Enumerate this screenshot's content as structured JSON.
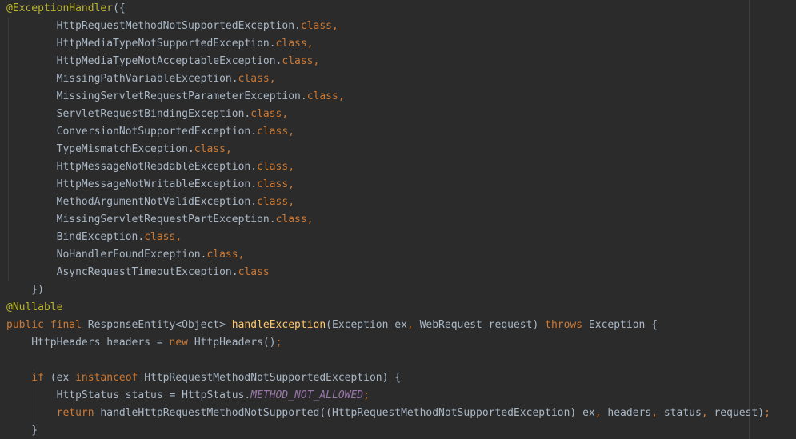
{
  "code": {
    "lines": [
      [
        {
          "t": "@ExceptionHandler",
          "k": "annotation"
        },
        {
          "t": "({",
          "k": "plain"
        }
      ],
      [
        {
          "t": "        HttpRequestMethodNotSupportedException.",
          "k": "plain"
        },
        {
          "t": "class",
          "k": "keyword"
        },
        {
          "t": ",",
          "k": "keyword"
        }
      ],
      [
        {
          "t": "        HttpMediaTypeNotSupportedException.",
          "k": "plain"
        },
        {
          "t": "class",
          "k": "keyword"
        },
        {
          "t": ",",
          "k": "keyword"
        }
      ],
      [
        {
          "t": "        HttpMediaTypeNotAcceptableException.",
          "k": "plain"
        },
        {
          "t": "class",
          "k": "keyword"
        },
        {
          "t": ",",
          "k": "keyword"
        }
      ],
      [
        {
          "t": "        MissingPathVariableException.",
          "k": "plain"
        },
        {
          "t": "class",
          "k": "keyword"
        },
        {
          "t": ",",
          "k": "keyword"
        }
      ],
      [
        {
          "t": "        MissingServletRequestParameterException.",
          "k": "plain"
        },
        {
          "t": "class",
          "k": "keyword"
        },
        {
          "t": ",",
          "k": "keyword"
        }
      ],
      [
        {
          "t": "        ServletRequestBindingException.",
          "k": "plain"
        },
        {
          "t": "class",
          "k": "keyword"
        },
        {
          "t": ",",
          "k": "keyword"
        }
      ],
      [
        {
          "t": "        ConversionNotSupportedException.",
          "k": "plain"
        },
        {
          "t": "class",
          "k": "keyword"
        },
        {
          "t": ",",
          "k": "keyword"
        }
      ],
      [
        {
          "t": "        TypeMismatchException.",
          "k": "plain"
        },
        {
          "t": "class",
          "k": "keyword"
        },
        {
          "t": ",",
          "k": "keyword"
        }
      ],
      [
        {
          "t": "        HttpMessageNotReadableException.",
          "k": "plain"
        },
        {
          "t": "class",
          "k": "keyword"
        },
        {
          "t": ",",
          "k": "keyword"
        }
      ],
      [
        {
          "t": "        HttpMessageNotWritableException.",
          "k": "plain"
        },
        {
          "t": "class",
          "k": "keyword"
        },
        {
          "t": ",",
          "k": "keyword"
        }
      ],
      [
        {
          "t": "        MethodArgumentNotValidException.",
          "k": "plain"
        },
        {
          "t": "class",
          "k": "keyword"
        },
        {
          "t": ",",
          "k": "keyword"
        }
      ],
      [
        {
          "t": "        MissingServletRequestPartException.",
          "k": "plain"
        },
        {
          "t": "class",
          "k": "keyword"
        },
        {
          "t": ",",
          "k": "keyword"
        }
      ],
      [
        {
          "t": "        BindException.",
          "k": "plain"
        },
        {
          "t": "class",
          "k": "keyword"
        },
        {
          "t": ",",
          "k": "keyword"
        }
      ],
      [
        {
          "t": "        NoHandlerFoundException.",
          "k": "plain"
        },
        {
          "t": "class",
          "k": "keyword"
        },
        {
          "t": ",",
          "k": "keyword"
        }
      ],
      [
        {
          "t": "        AsyncRequestTimeoutException.",
          "k": "plain"
        },
        {
          "t": "class",
          "k": "keyword"
        }
      ],
      [
        {
          "t": "    })",
          "k": "plain"
        }
      ],
      [
        {
          "t": "@Nullable",
          "k": "annotation"
        }
      ],
      [
        {
          "t": "public final ",
          "k": "keyword"
        },
        {
          "t": "ResponseEntity<Object> ",
          "k": "plain"
        },
        {
          "t": "handleException",
          "k": "method"
        },
        {
          "t": "(Exception ex",
          "k": "plain"
        },
        {
          "t": ", ",
          "k": "keyword"
        },
        {
          "t": "WebRequest request) ",
          "k": "plain"
        },
        {
          "t": "throws ",
          "k": "keyword"
        },
        {
          "t": "Exception {",
          "k": "plain"
        }
      ],
      [
        {
          "t": "    HttpHeaders headers = ",
          "k": "plain"
        },
        {
          "t": "new ",
          "k": "keyword"
        },
        {
          "t": "HttpHeaders()",
          "k": "plain"
        },
        {
          "t": ";",
          "k": "keyword"
        }
      ],
      [
        {
          "t": "",
          "k": "plain"
        }
      ],
      [
        {
          "t": "    ",
          "k": "plain"
        },
        {
          "t": "if ",
          "k": "keyword"
        },
        {
          "t": "(ex ",
          "k": "plain"
        },
        {
          "t": "instanceof ",
          "k": "keyword"
        },
        {
          "t": "HttpRequestMethodNotSupportedException) {",
          "k": "plain"
        }
      ],
      [
        {
          "t": "        HttpStatus status = HttpStatus.",
          "k": "plain"
        },
        {
          "t": "METHOD_NOT_ALLOWED",
          "k": "constant"
        },
        {
          "t": ";",
          "k": "keyword"
        }
      ],
      [
        {
          "t": "        ",
          "k": "plain"
        },
        {
          "t": "return ",
          "k": "keyword"
        },
        {
          "t": "handleHttpRequestMethodNotSupported((HttpRequestMethodNotSupportedException) ex",
          "k": "plain"
        },
        {
          "t": ", ",
          "k": "keyword"
        },
        {
          "t": "headers",
          "k": "plain"
        },
        {
          "t": ", ",
          "k": "keyword"
        },
        {
          "t": "status",
          "k": "plain"
        },
        {
          "t": ", ",
          "k": "keyword"
        },
        {
          "t": "request)",
          "k": "plain"
        },
        {
          "t": ";",
          "k": "keyword"
        }
      ],
      [
        {
          "t": "    }",
          "k": "plain"
        }
      ]
    ]
  },
  "theme": {
    "background": "#2b2b2b",
    "plain": "#a9b7c6",
    "keyword": "#cc7832",
    "annotation": "#bbb529",
    "method": "#ffc66d",
    "constant": "#9876aa"
  }
}
